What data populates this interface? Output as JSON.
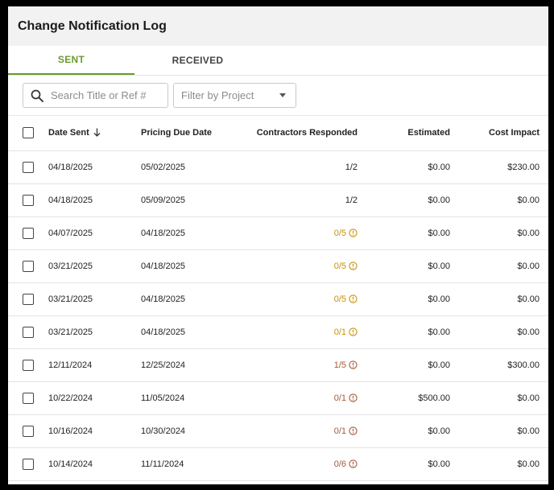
{
  "header": {
    "title": "Change Notification Log"
  },
  "tabs": [
    {
      "label": "SENT",
      "active": true
    },
    {
      "label": "RECEIVED",
      "active": false
    }
  ],
  "toolbar": {
    "search_placeholder": "Search Title or Ref #",
    "filter_placeholder": "Filter by Project"
  },
  "table": {
    "columns": [
      "Date Sent",
      "Pricing Due Date",
      "Contractors Responded",
      "Estimated",
      "Cost Impact"
    ],
    "sort": {
      "column": "Date Sent",
      "direction": "descending"
    },
    "rows": [
      {
        "date_sent": "04/18/2025",
        "due": "05/02/2025",
        "responded": "1/2",
        "status": "complete",
        "estimated": "$0.00",
        "cost_impact": "$230.00"
      },
      {
        "date_sent": "04/18/2025",
        "due": "05/09/2025",
        "responded": "1/2",
        "status": "complete",
        "estimated": "$0.00",
        "cost_impact": "$0.00"
      },
      {
        "date_sent": "04/07/2025",
        "due": "04/18/2025",
        "responded": "0/5",
        "status": "warning",
        "estimated": "$0.00",
        "cost_impact": "$0.00"
      },
      {
        "date_sent": "03/21/2025",
        "due": "04/18/2025",
        "responded": "0/5",
        "status": "warning",
        "estimated": "$0.00",
        "cost_impact": "$0.00"
      },
      {
        "date_sent": "03/21/2025",
        "due": "04/18/2025",
        "responded": "0/5",
        "status": "warning",
        "estimated": "$0.00",
        "cost_impact": "$0.00"
      },
      {
        "date_sent": "03/21/2025",
        "due": "04/18/2025",
        "responded": "0/1",
        "status": "warning",
        "estimated": "$0.00",
        "cost_impact": "$0.00"
      },
      {
        "date_sent": "12/11/2024",
        "due": "12/25/2024",
        "responded": "1/5",
        "status": "overdue",
        "estimated": "$0.00",
        "cost_impact": "$300.00"
      },
      {
        "date_sent": "10/22/2024",
        "due": "11/05/2024",
        "responded": "0/1",
        "status": "overdue",
        "estimated": "$500.00",
        "cost_impact": "$0.00"
      },
      {
        "date_sent": "10/16/2024",
        "due": "10/30/2024",
        "responded": "0/1",
        "status": "overdue",
        "estimated": "$0.00",
        "cost_impact": "$0.00"
      },
      {
        "date_sent": "10/14/2024",
        "due": "11/11/2024",
        "responded": "0/6",
        "status": "overdue",
        "estimated": "$0.00",
        "cost_impact": "$0.00"
      }
    ]
  },
  "colors": {
    "accent": "#6b9a2f",
    "warning": "#c8900a",
    "overdue": "#a35a3a",
    "header_bg": "#f1f2f1"
  },
  "icons": {
    "search": "search-icon",
    "sort": "arrow-down-icon",
    "dropdown": "caret-down-icon",
    "status": "info-circle-icon"
  }
}
